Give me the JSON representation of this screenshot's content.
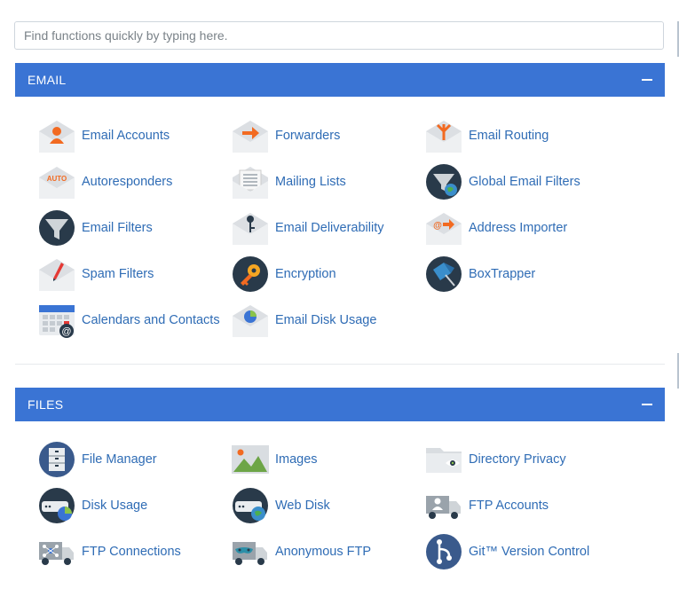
{
  "search": {
    "placeholder": "Find functions quickly by typing here."
  },
  "email": {
    "title": "EMAIL",
    "items": [
      {
        "label": "Email Accounts",
        "icon": "email-accounts-icon"
      },
      {
        "label": "Forwarders",
        "icon": "forwarders-icon"
      },
      {
        "label": "Email Routing",
        "icon": "email-routing-icon"
      },
      {
        "label": "Autoresponders",
        "icon": "autoresponders-icon"
      },
      {
        "label": "Mailing Lists",
        "icon": "mailing-lists-icon"
      },
      {
        "label": "Global Email Filters",
        "icon": "global-email-filters-icon"
      },
      {
        "label": "Email Filters",
        "icon": "email-filters-icon"
      },
      {
        "label": "Email Deliverability",
        "icon": "email-deliverability-icon"
      },
      {
        "label": "Address Importer",
        "icon": "address-importer-icon"
      },
      {
        "label": "Spam Filters",
        "icon": "spam-filters-icon"
      },
      {
        "label": "Encryption",
        "icon": "encryption-icon"
      },
      {
        "label": "BoxTrapper",
        "icon": "boxtrapper-icon"
      },
      {
        "label": "Calendars and Contacts",
        "icon": "calendars-contacts-icon"
      },
      {
        "label": "Email Disk Usage",
        "icon": "email-disk-usage-icon"
      }
    ],
    "autoresponder_badge": "AUTO"
  },
  "files": {
    "title": "FILES",
    "items": [
      {
        "label": "File Manager",
        "icon": "file-manager-icon"
      },
      {
        "label": "Images",
        "icon": "images-icon"
      },
      {
        "label": "Directory Privacy",
        "icon": "directory-privacy-icon"
      },
      {
        "label": "Disk Usage",
        "icon": "disk-usage-icon"
      },
      {
        "label": "Web Disk",
        "icon": "web-disk-icon"
      },
      {
        "label": "FTP Accounts",
        "icon": "ftp-accounts-icon"
      },
      {
        "label": "FTP Connections",
        "icon": "ftp-connections-icon"
      },
      {
        "label": "Anonymous FTP",
        "icon": "anonymous-ftp-icon"
      },
      {
        "label": "Git™ Version Control",
        "icon": "git-version-control-icon"
      }
    ]
  },
  "colors": {
    "header": "#3a74d4",
    "link": "#2f6cb5",
    "accent_orange": "#f26a21",
    "dark_navy": "#293a4a"
  }
}
